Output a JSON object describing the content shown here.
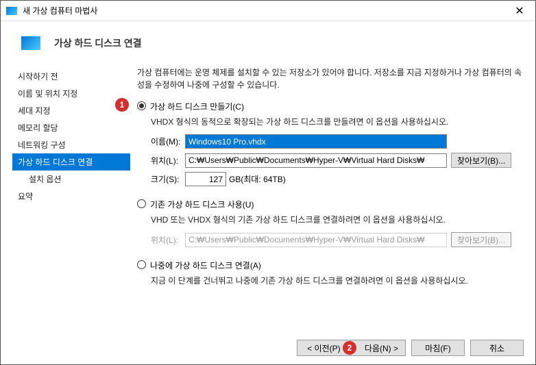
{
  "titlebar": {
    "text": "새 가상 컴퓨터 마법사"
  },
  "header": {
    "title": "가상 하드 디스크 연결"
  },
  "sidebar": {
    "items": [
      {
        "label": "시작하기 전"
      },
      {
        "label": "이름 및 위치 지정"
      },
      {
        "label": "세대 지정"
      },
      {
        "label": "메모리 할당"
      },
      {
        "label": "네트워킹 구성"
      },
      {
        "label": "가상 하드 디스크 연결"
      },
      {
        "label": "설치 옵션"
      },
      {
        "label": "요약"
      }
    ]
  },
  "main": {
    "description": "가상 컴퓨터에는 운영 체제를 설치할 수 있는 저장소가 있어야 합니다. 저장소를 지금 지정하거나 가상 컴퓨터의 속성을 수정하여 나중에 구성할 수 있습니다.",
    "opt1": {
      "label": "가상 하드 디스크 만들기(C)",
      "desc": "VHDX 형식의 동적으로 확장되는 가상 하드 디스크를 만들려면 이 옵션을 사용하십시오.",
      "name_label": "이름(M):",
      "name_value": "Windows10 Pro.vhdx",
      "loc_label": "위치(L):",
      "loc_value": "C:₩Users₩Public₩Documents₩Hyper-V₩Virtual Hard Disks₩",
      "browse": "찾아보기(B)...",
      "size_label": "크기(S):",
      "size_value": "127",
      "size_unit": "GB(최대: 64TB)"
    },
    "opt2": {
      "label": "기존 가상 하드 디스크 사용(U)",
      "desc": "VHD 또는 VHDX 형식의 기존 가상 하드 디스크를 연결하려면 이 옵션을 사용하십시오.",
      "loc_label": "위치(L):",
      "loc_value": "C:₩Users₩Public₩Documents₩Hyper-V₩Virtual Hard Disks₩",
      "browse": "찾아보기(B)..."
    },
    "opt3": {
      "label": "나중에 가상 하드 디스크 연결(A)",
      "desc": "지금 이 단계를 건너뛰고 나중에 기존 가상 하드 디스크를 연결하려면 이 옵션을 사용하십시오."
    }
  },
  "footer": {
    "prev": "< 이전(P)",
    "next": "다음(N) >",
    "finish": "마침(F)",
    "cancel": "취소"
  },
  "markers": {
    "m1": "1",
    "m2": "2"
  }
}
